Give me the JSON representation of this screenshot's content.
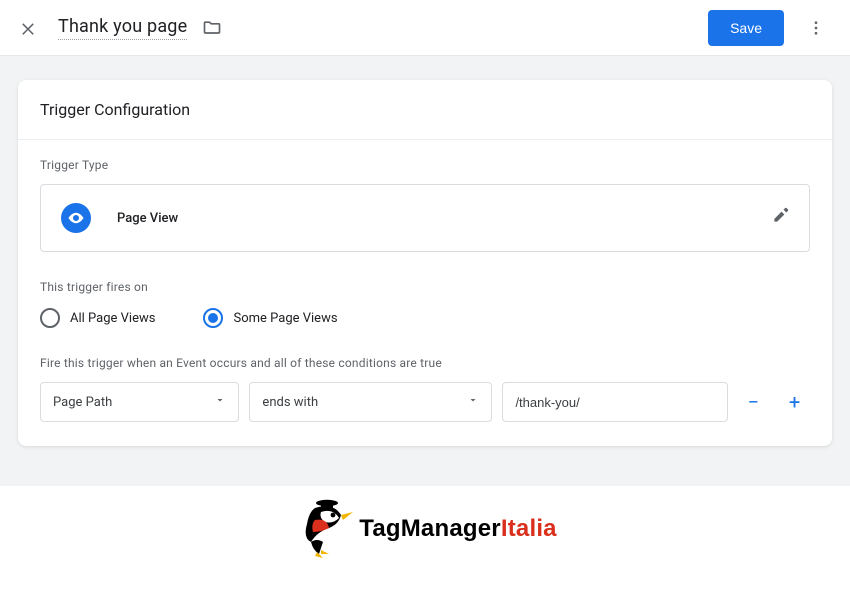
{
  "header": {
    "title": "Thank you page",
    "save_label": "Save"
  },
  "card": {
    "title": "Trigger Configuration",
    "trigger_type_label": "Trigger Type",
    "trigger_type_value": "Page View",
    "fires_on_label": "This trigger fires on",
    "fires_all": "All Page Views",
    "fires_some": "Some Page Views",
    "condition_hint": "Fire this trigger when an Event occurs and all of these conditions are true",
    "condition": {
      "variable": "Page Path",
      "operator": "ends with",
      "value": "/thank-you/"
    }
  },
  "logo": {
    "name": "TagManager",
    "suffix": "Italia"
  }
}
